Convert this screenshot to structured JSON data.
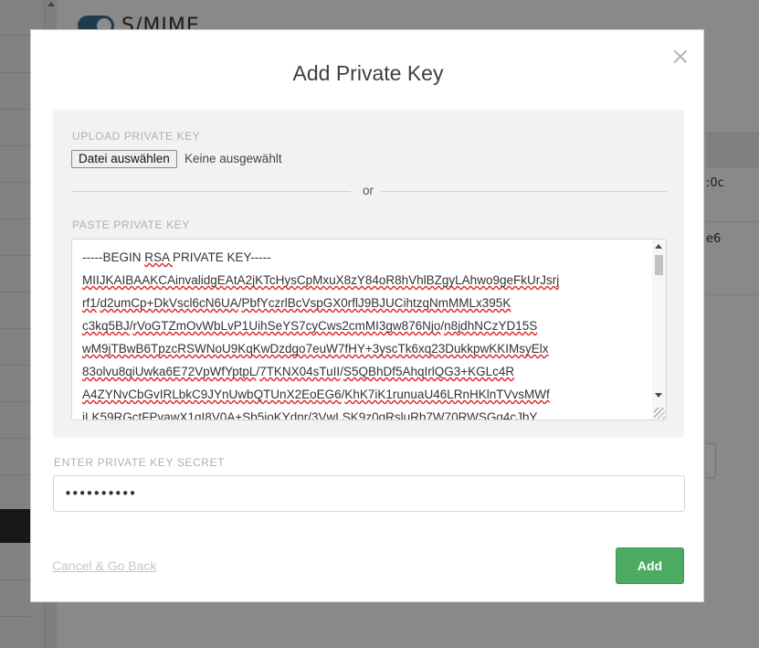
{
  "background": {
    "section_title": "S/MIME",
    "cell_1": ":0c",
    "cell_2": "e6"
  },
  "modal": {
    "title": "Add Private Key",
    "close_icon": "close-icon",
    "upload": {
      "label": "UPLOAD PRIVATE KEY",
      "button_label": "Datei auswählen",
      "status": "Keine ausgewählt"
    },
    "divider_text": "or",
    "paste": {
      "label": "PASTE PRIVATE KEY",
      "lines": [
        "-----BEGIN RSA PRIVATE KEY-----",
        "MIIJKAIBAAKCAinvalidgEAtA2jKTcHysCpMxuX8zY84oR8hVhlBZgyLAhwo9geFkUrJsrj",
        "rf1/d2umCp+DkVscl6cN6UA/PbfYczrlBcVspGX0rflJ9BJUCihtzqNmMMLx395K",
        "c3kq5BJ/rVoGTZmOvWbLvP1UihSeYS7cyCws2cmMI3gw876Njo/n8jdhNCzYD15S",
        "wM9jTBwB6TpzcRSWNoU9KqKwDzdgo7euW7fHY+3yscTk6xq23DukkpwKKIMsyElx",
        "83olvu8qiUwka6E72VpWfYptpL/7TKNX04sTuII/S5QBhDf5AhqIrlQG3+KGLc4R",
        "A4ZYNvCbGvIRLbkC9JYnUwbQTUnX2EoEG6/KhK7iK1runuaU46LRnHKlnTVvsMWf",
        "iLK59RGctFPvawX1qI8V0A+Sb5ioKYdnr/3VwLSK9z0gRsluRb7W70RWSGq4cJbY"
      ]
    },
    "secret": {
      "label": "ENTER PRIVATE KEY SECRET",
      "value": "••••••••••"
    },
    "cancel_label": "Cancel & Go Back",
    "add_label": "Add"
  },
  "colors": {
    "add_button": "#4caa62",
    "label_text": "#a6b3bd",
    "panel_bg": "#f2f2f2"
  }
}
